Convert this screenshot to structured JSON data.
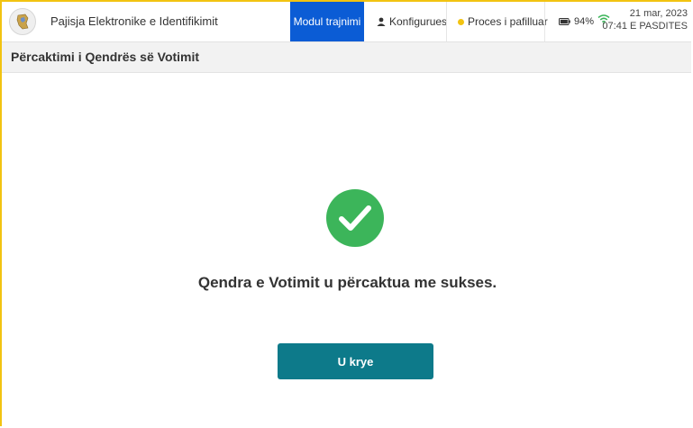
{
  "header": {
    "app_title": "Pajisja Elektronike e Identifikimit",
    "mode_tab": "Modul trajnimi",
    "role_label": "Konfigurues",
    "role_icon": "user-icon",
    "status_label": "Proces i pafilluar",
    "status_color": "#f2c311",
    "battery_percent": "94%",
    "battery_icon": "battery-icon",
    "wifi_icon": "wifi-icon",
    "date": "21 mar, 2023",
    "time": "07:41 E PASDITES"
  },
  "page": {
    "title": "Përcaktimi i Qendrës së Votimit"
  },
  "main": {
    "success_icon": "check-circle-icon",
    "success_color": "#3cb55a",
    "message": "Qendra e Votimit u përcaktua me sukses.",
    "home_button_label": "U krye",
    "home_button_color": "#0d7a8a"
  },
  "colors": {
    "accent_blue": "#0b5cd5",
    "frame_border": "#f2c311"
  }
}
